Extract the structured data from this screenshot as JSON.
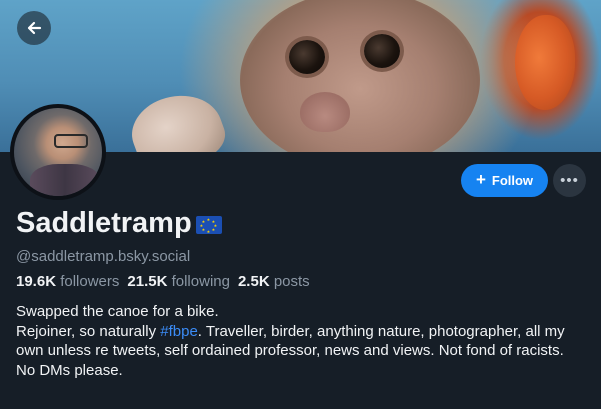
{
  "header": {
    "back_icon": "arrow-left-icon"
  },
  "profile": {
    "display_name": "Saddletramp",
    "flag_emoji": "eu-flag",
    "handle": "@saddletramp.bsky.social",
    "follow_label": "Follow",
    "more_icon": "ellipsis-icon",
    "stats": {
      "followers_count": "19.6K",
      "followers_label": "followers",
      "following_count": "21.5K",
      "following_label": "following",
      "posts_count": "2.5K",
      "posts_label": "posts"
    },
    "bio": {
      "line1": "Swapped the canoe for a bike.",
      "line2_prefix": "Rejoiner, so naturally ",
      "line2_tag": "#fbpe",
      "line2_suffix": ". Traveller, birder, anything nature, photographer, all my own unless re tweets, self ordained professor, news and views. Not fond of racists.",
      "line3": "No DMs please."
    }
  },
  "colors": {
    "background": "#161e27",
    "accent": "#1683f1",
    "muted_text": "#8b97a4",
    "hashtag": "#3b8cf7"
  }
}
